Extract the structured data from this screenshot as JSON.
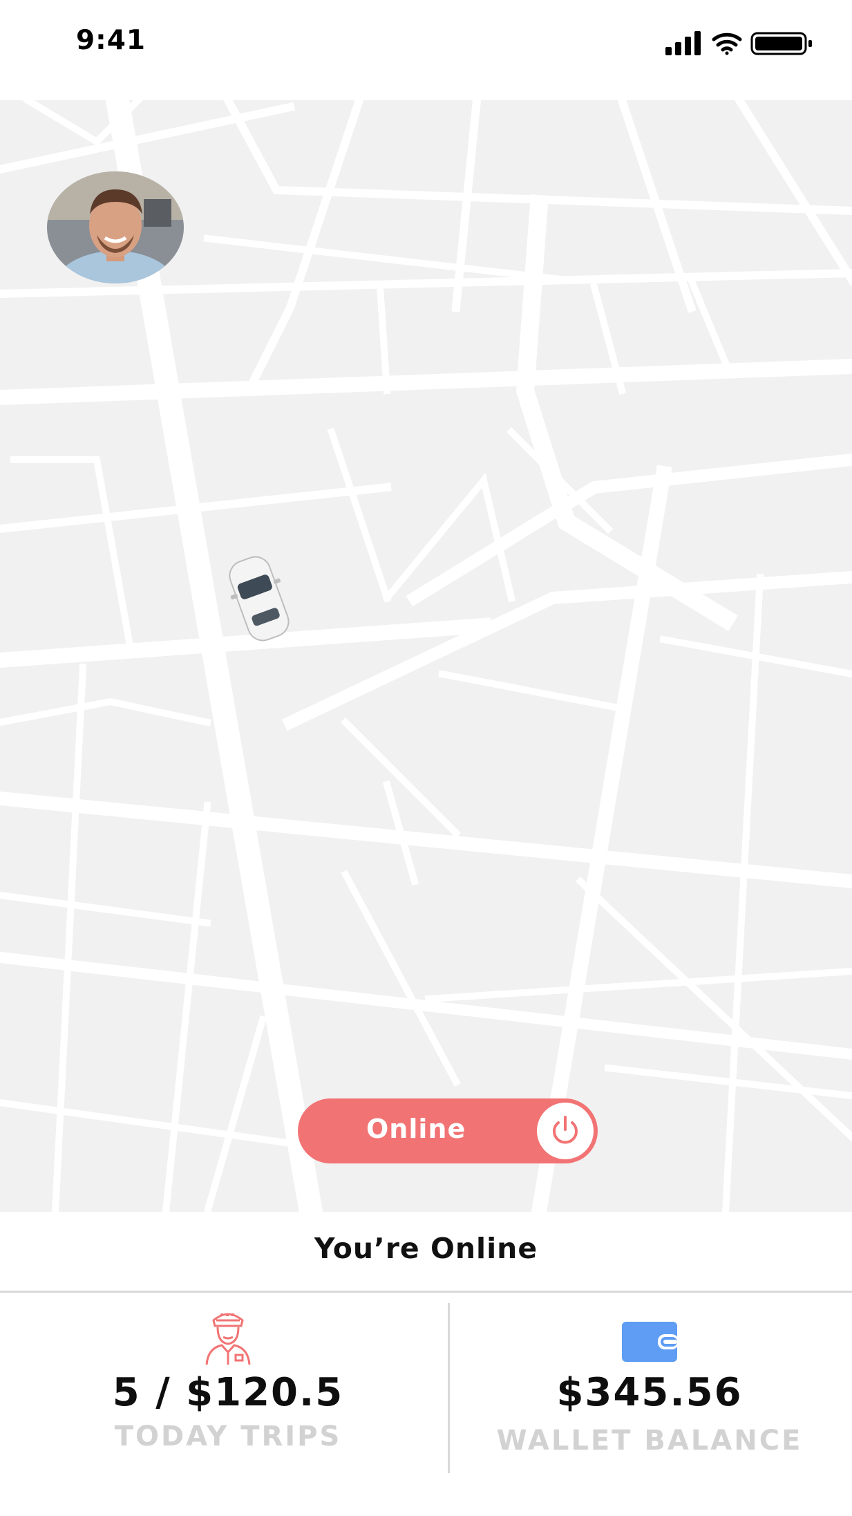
{
  "status_bar": {
    "time": "9:41",
    "icons": [
      "signal-icon",
      "wifi-icon",
      "battery-icon"
    ]
  },
  "map": {
    "avatar": "driver-avatar",
    "vehicle": "car-icon"
  },
  "toggle": {
    "label": "Online",
    "icon": "power-icon",
    "state": "on"
  },
  "status_text": "You’re Online",
  "stats": {
    "trips": {
      "icon": "driver-icon",
      "value": "5 / $120.5",
      "label": "TODAY TRIPS"
    },
    "wallet": {
      "icon": "wallet-icon",
      "value": "$345.56",
      "label": "WALLET BALANCE"
    }
  },
  "colors": {
    "accent": "#f27374",
    "wallet_blue": "#5f9cf3",
    "label_gray": "#d2d2d2",
    "map_block": "#f1f1f1",
    "road": "#ffffff"
  }
}
